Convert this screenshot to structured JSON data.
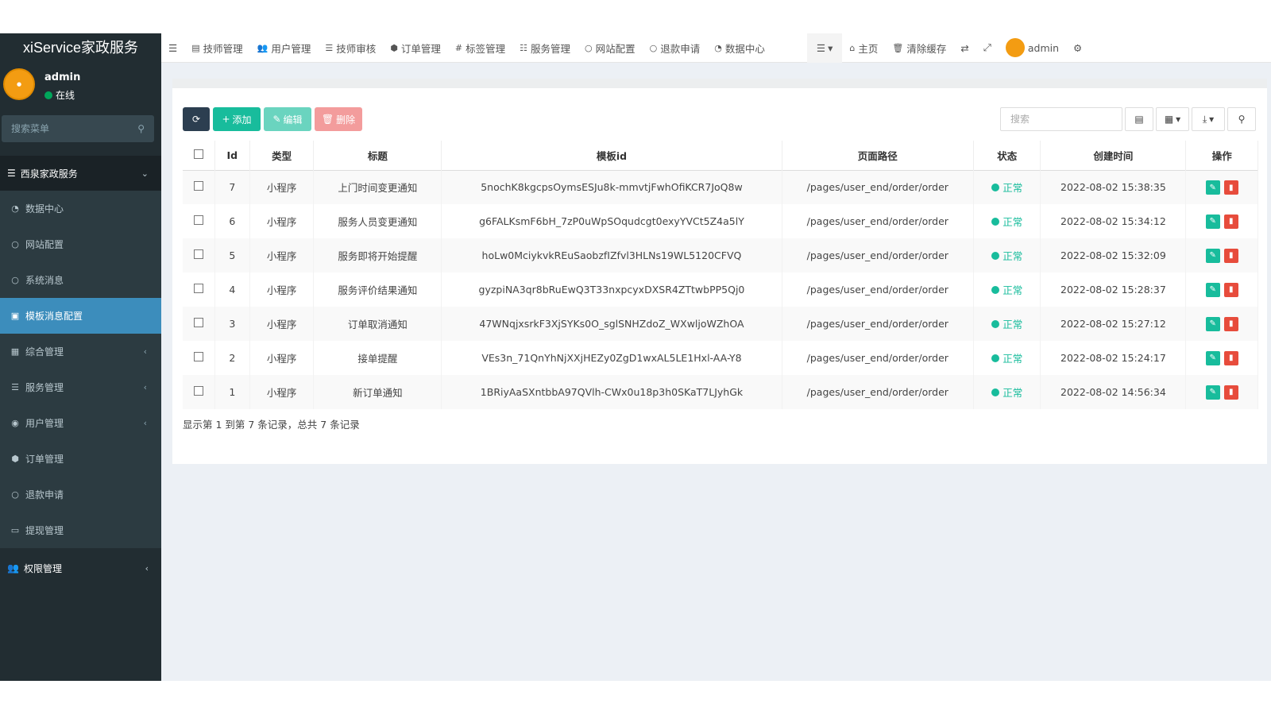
{
  "app": {
    "logo": "xiService家政服务"
  },
  "user": {
    "name": "admin",
    "status": "在线"
  },
  "sidebar": {
    "search_placeholder": "搜索菜单",
    "header": "西泉家政服务",
    "items": [
      {
        "label": "数据中心",
        "icon": "dashboard-icon"
      },
      {
        "label": "网站配置",
        "icon": "circle-icon"
      },
      {
        "label": "系统消息",
        "icon": "circle-icon"
      },
      {
        "label": "模板消息配置",
        "icon": "square-icon",
        "active": true
      },
      {
        "label": "综合管理",
        "icon": "grid-icon"
      },
      {
        "label": "服务管理",
        "icon": "list-icon"
      },
      {
        "label": "用户管理",
        "icon": "user-icon"
      },
      {
        "label": "订单管理",
        "icon": "cube-icon"
      },
      {
        "label": "退款申请",
        "icon": "circle-icon"
      },
      {
        "label": "提现管理",
        "icon": "money-icon"
      }
    ],
    "bottom": "权限管理"
  },
  "topbar": {
    "items": [
      "技师管理",
      "用户管理",
      "技师审核",
      "订单管理",
      "标签管理",
      "服务管理",
      "网站配置",
      "退款申请",
      "数据中心"
    ],
    "home": "主页",
    "clear_cache": "清除缓存",
    "admin": "admin"
  },
  "toolbar": {
    "add": "添加",
    "edit": "编辑",
    "delete": "删除",
    "search_placeholder": "搜索"
  },
  "table": {
    "headers": [
      "Id",
      "类型",
      "标题",
      "模板id",
      "页面路径",
      "状态",
      "创建时间",
      "操作"
    ],
    "rows": [
      {
        "id": "7",
        "type": "小程序",
        "title": "上门时间变更通知",
        "template_id": "5nochK8kgcpsOymsESJu8k-mmvtjFwhOfiKCR7JoQ8w",
        "path": "/pages/user_end/order/order",
        "status": "正常",
        "created": "2022-08-02 15:38:35"
      },
      {
        "id": "6",
        "type": "小程序",
        "title": "服务人员变更通知",
        "template_id": "g6FALKsmF6bH_7zP0uWpSOqudcgt0exyYVCt5Z4a5lY",
        "path": "/pages/user_end/order/order",
        "status": "正常",
        "created": "2022-08-02 15:34:12"
      },
      {
        "id": "5",
        "type": "小程序",
        "title": "服务即将开始提醒",
        "template_id": "hoLw0MciykvkREuSaobzfIZfvl3HLNs19WL5120CFVQ",
        "path": "/pages/user_end/order/order",
        "status": "正常",
        "created": "2022-08-02 15:32:09"
      },
      {
        "id": "4",
        "type": "小程序",
        "title": "服务评价结果通知",
        "template_id": "gyzpiNA3qr8bRuEwQ3T33nxpcyxDXSR4ZTtwbPP5Qj0",
        "path": "/pages/user_end/order/order",
        "status": "正常",
        "created": "2022-08-02 15:28:37"
      },
      {
        "id": "3",
        "type": "小程序",
        "title": "订单取消通知",
        "template_id": "47WNqjxsrkF3XjSYKs0O_sglSNHZdoZ_WXwljoWZhOA",
        "path": "/pages/user_end/order/order",
        "status": "正常",
        "created": "2022-08-02 15:27:12"
      },
      {
        "id": "2",
        "type": "小程序",
        "title": "接单提醒",
        "template_id": "VEs3n_71QnYhNjXXjHEZy0ZgD1wxAL5LE1Hxl-AA-Y8",
        "path": "/pages/user_end/order/order",
        "status": "正常",
        "created": "2022-08-02 15:24:17"
      },
      {
        "id": "1",
        "type": "小程序",
        "title": "新订单通知",
        "template_id": "1BRiyAaSXntbbA97QVlh-CWx0u18p3h0SKaT7LJyhGk",
        "path": "/pages/user_end/order/order",
        "status": "正常",
        "created": "2022-08-02 14:56:34"
      }
    ]
  },
  "footer": {
    "info": "显示第 1 到第 7 条记录，总共 7 条记录"
  },
  "colors": {
    "accent": "#18bc9c",
    "sidebar_bg": "#222d32",
    "active": "#3c8dbc",
    "danger": "#e74c3c"
  }
}
